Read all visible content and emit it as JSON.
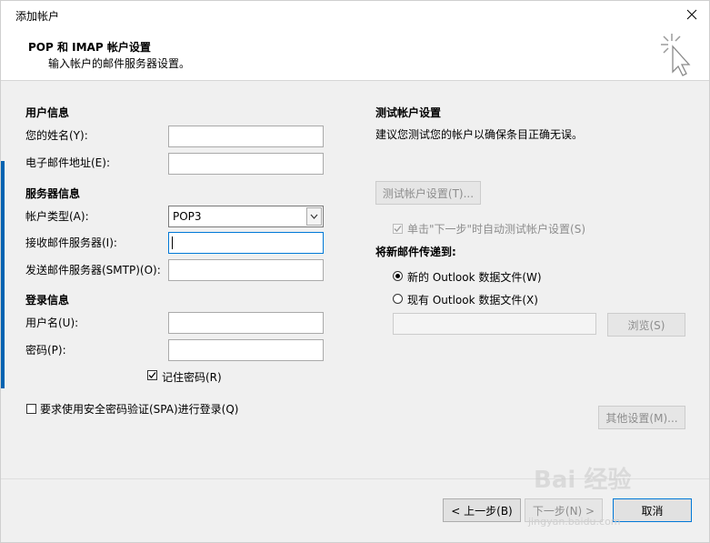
{
  "window": {
    "title": "添加帐户",
    "close_symbol": "✕"
  },
  "header": {
    "title": "POP 和 IMAP 帐户设置",
    "subtitle": "输入帐户的邮件服务器设置。",
    "icon": "wizard-cursor-icon"
  },
  "user_info": {
    "section_title": "用户信息",
    "name_label": "您的姓名(Y):",
    "name_value": "",
    "email_label": "电子邮件地址(E):",
    "email_value": ""
  },
  "server_info": {
    "section_title": "服务器信息",
    "account_type_label": "帐户类型(A):",
    "account_type_value": "POP3",
    "incoming_label": "接收邮件服务器(I):",
    "incoming_value": "",
    "outgoing_label": "发送邮件服务器(SMTP)(O):",
    "outgoing_value": ""
  },
  "login_info": {
    "section_title": "登录信息",
    "username_label": "用户名(U):",
    "username_value": "",
    "password_label": "密码(P):",
    "password_value": "",
    "remember_password_label": "记住密码(R)",
    "remember_password_checked": true,
    "spa_label": "要求使用安全密码验证(SPA)进行登录(Q)",
    "spa_checked": false
  },
  "test_settings": {
    "section_title": "测试帐户设置",
    "description": "建议您测试您的帐户以确保条目正确无误。",
    "test_button_label": "测试帐户设置(T)...",
    "auto_test_label": "单击\"下一步\"时自动测试帐户设置(S)",
    "auto_test_checked": true
  },
  "deliver_to": {
    "section_title": "将新邮件传递到:",
    "new_datafile_label": "新的 Outlook 数据文件(W)",
    "existing_datafile_label": "现有 Outlook 数据文件(X)",
    "selected": "new",
    "existing_path_value": "",
    "browse_button_label": "浏览(S)"
  },
  "more_settings_button_label": "其他设置(M)...",
  "footer": {
    "back_button_label": "< 上一步(B)",
    "next_button_label": "下一步(N) >",
    "cancel_button_label": "取消"
  },
  "watermark": {
    "main": "Bai 经验",
    "sub": "jingyan.baidu.com"
  },
  "colors": {
    "accent": "#0078d7",
    "window_bg": "#f0f0f0",
    "disabled_text": "#8d8d8d"
  }
}
